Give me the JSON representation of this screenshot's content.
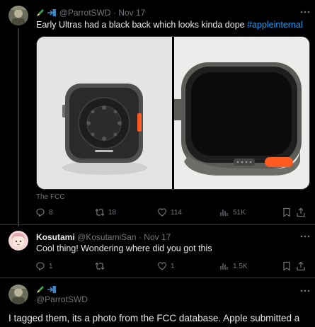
{
  "tweet1": {
    "handle": "@ParrotSWD",
    "sep": "·",
    "time": "Nov 17",
    "text": "Early Ultras had a black back which looks kinda dope",
    "hashtag": "#appleinternal",
    "media_caption": "The FCC",
    "counts": {
      "replies": "8",
      "retweets": "18",
      "likes": "114",
      "views": "51K"
    }
  },
  "tweet2": {
    "display_name": "Kosutami",
    "handle": "@KosutamiSan",
    "sep": "·",
    "time": "Nov 17",
    "text": "Cool thing! Wondering where did you got this",
    "counts": {
      "replies": "1",
      "retweets": "",
      "likes": "1",
      "views": "1.5K"
    }
  },
  "tweet3": {
    "handle": "@ParrotSWD",
    "text": "I tagged them, its a photo from the FCC database. Apple submitted a"
  },
  "colors": {
    "background": "#000000",
    "link": "#1d9bf0",
    "muted": "#71767b",
    "text": "#e7e9ea",
    "watch_button": "#ff5a1f"
  }
}
